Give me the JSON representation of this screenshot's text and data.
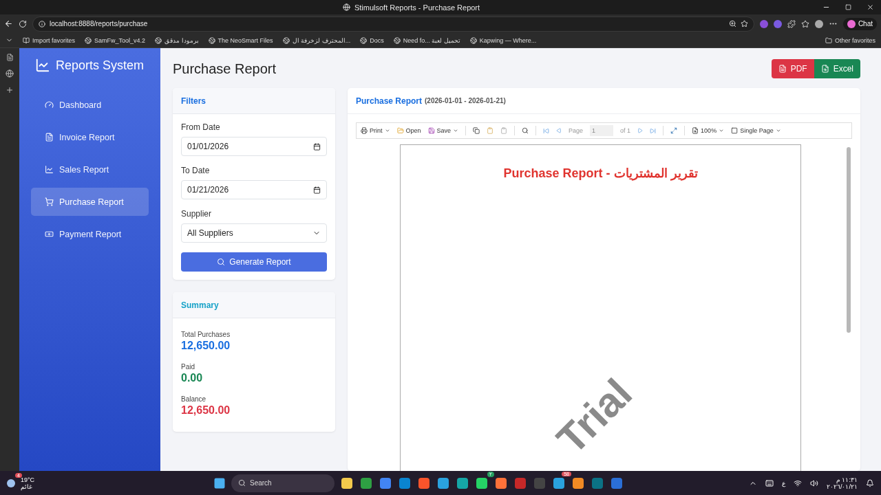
{
  "browser": {
    "tab_title": "Stimulsoft Reports - Purchase Report",
    "url": "localhost:8888/reports/purchase",
    "chat_label": "Chat",
    "bookmarks": [
      "Import favorites",
      "SamFw_Tool_v4.2",
      "برمودا مدقق",
      "The NeoSmart Files",
      "المحترف لزخرفة ال...",
      "Docs",
      "Need fo... تحميل لعبة",
      "Kapwing — Where..."
    ],
    "other_favorites": "Other favorites"
  },
  "sidebar": {
    "brand": "Reports System",
    "items": [
      {
        "label": "Dashboard",
        "selected": false
      },
      {
        "label": "Invoice Report",
        "selected": false
      },
      {
        "label": "Sales Report",
        "selected": false
      },
      {
        "label": "Purchase Report",
        "selected": true
      },
      {
        "label": "Payment Report",
        "selected": false
      }
    ]
  },
  "page": {
    "title": "Purchase Report",
    "export_buttons": [
      {
        "label": "PDF",
        "kind": "pdf"
      },
      {
        "label": "Excel",
        "kind": "excel"
      }
    ]
  },
  "filters": {
    "title": "Filters",
    "fields": [
      {
        "label": "From Date",
        "value": "01/01/2026",
        "kind": "date"
      },
      {
        "label": "To Date",
        "value": "01/21/2026",
        "kind": "date"
      },
      {
        "label": "Supplier",
        "value": "All Suppliers",
        "kind": "select"
      }
    ],
    "button": "Generate Report"
  },
  "summary": {
    "title": "Summary",
    "items": [
      {
        "label": "Total Purchases",
        "value": "12,650.00",
        "color": "#1a6fe0"
      },
      {
        "label": "Paid",
        "value": "0.00",
        "color": "#198754"
      },
      {
        "label": "Balance",
        "value": "12,650.00",
        "color": "#dc3545"
      }
    ]
  },
  "viewer": {
    "title": "Purchase Report",
    "range": "(2026-01-01 - 2026-01-21)",
    "toolbar": {
      "print": "Print",
      "open": "Open",
      "save": "Save",
      "page_label": "Page",
      "page_value": "1",
      "page_count": "of 1",
      "zoom": "100%",
      "view_mode": "Single Page"
    },
    "report_title": "Purchase Report - تقرير المشتريات",
    "watermark": "Trial"
  },
  "taskbar": {
    "temperature": "19°C",
    "condition": "غائم",
    "weather_badge": "4",
    "search_placeholder": "Search",
    "app_badges": [
      "٢",
      "58"
    ],
    "keyboard": "ع",
    "time": "١١:٣١ م",
    "date": "٢٠٢٦/٠١/٢١"
  }
}
